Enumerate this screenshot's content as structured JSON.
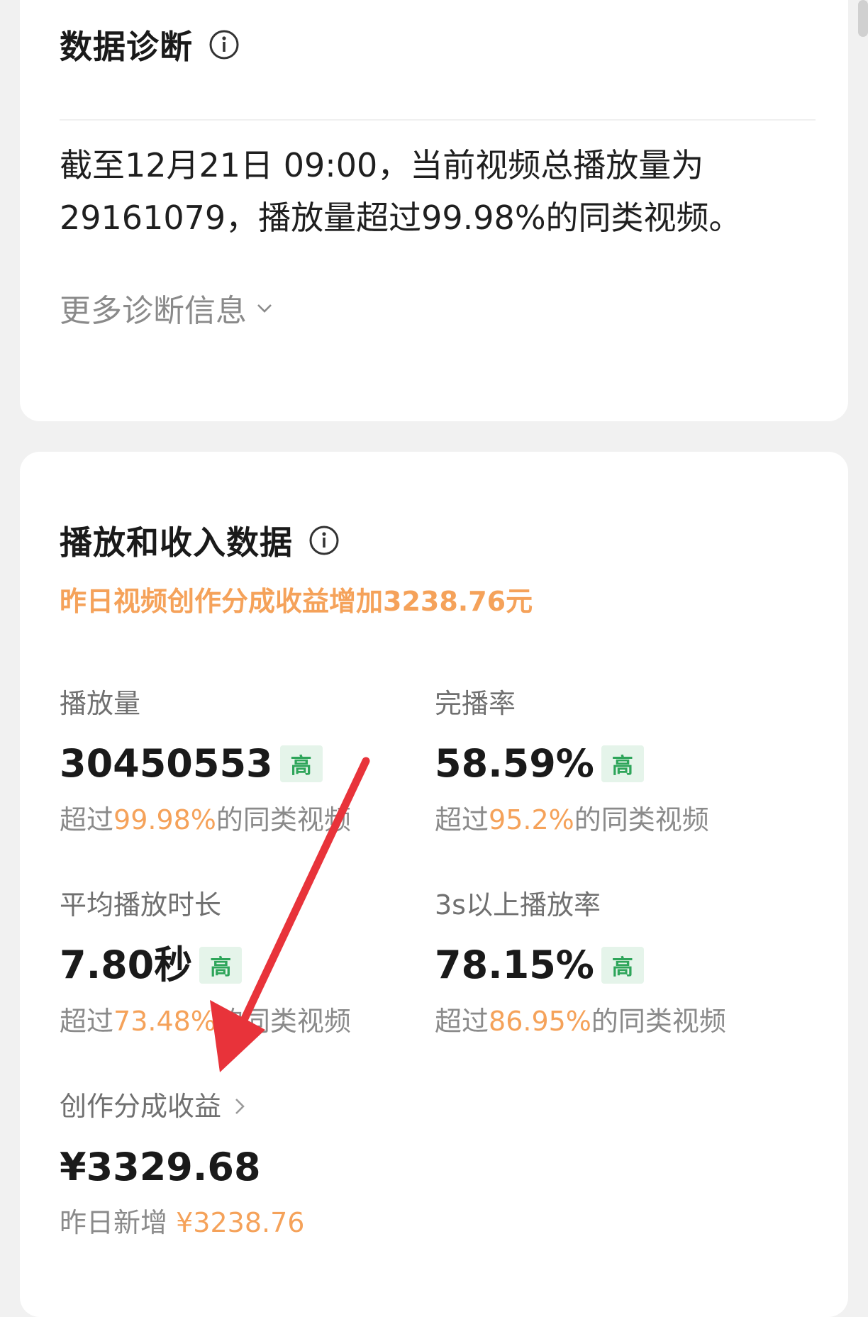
{
  "diagnosis": {
    "title": "数据诊断",
    "text": "截至12月21日 09:00，当前视频总播放量为29161079，播放量超过99.98%的同类视频。",
    "more_label": "更多诊断信息"
  },
  "metrics_card": {
    "title": "播放和收入数据",
    "highlight": "昨日视频创作分成收益增加3238.76元",
    "metrics": [
      {
        "label": "播放量",
        "value": "30450553",
        "badge": "高",
        "sub_prefix": "超过",
        "sub_pct": "99.98%",
        "sub_suffix": "的同类视频"
      },
      {
        "label": "完播率",
        "value": "58.59%",
        "badge": "高",
        "sub_prefix": "超过",
        "sub_pct": "95.2%",
        "sub_suffix": "的同类视频"
      },
      {
        "label": "平均播放时长",
        "value": "7.80秒",
        "badge": "高",
        "sub_prefix": "超过",
        "sub_pct": "73.48%",
        "sub_suffix": "的同类视频"
      },
      {
        "label": "3s以上播放率",
        "value": "78.15%",
        "badge": "高",
        "sub_prefix": "超过",
        "sub_pct": "86.95%",
        "sub_suffix": "的同类视频"
      }
    ],
    "revenue": {
      "label": "创作分成收益",
      "value": "¥3329.68",
      "sub_prefix": "昨日新增",
      "sub_amount": "¥3238.76"
    }
  },
  "icons": {
    "info": "info-circle-icon",
    "chevron_down": "chevron-down-icon",
    "chevron_right": "chevron-right-icon",
    "annotation_arrow": "red-arrow-annotation"
  },
  "colors": {
    "accent_orange": "#f5a25a",
    "badge_green": "#2ea55a",
    "badge_bg": "#e5f4ea",
    "arrow_red": "#e8333a"
  }
}
